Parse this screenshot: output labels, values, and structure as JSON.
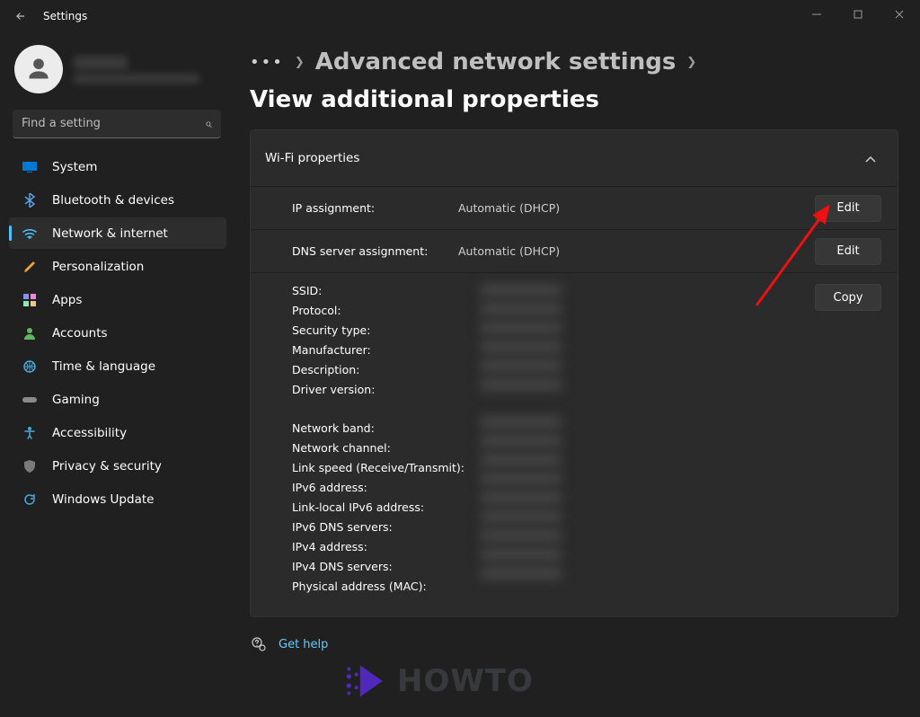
{
  "titlebar": {
    "title": "Settings"
  },
  "search": {
    "placeholder": "Find a setting"
  },
  "sidebar": {
    "items": [
      {
        "label": "System"
      },
      {
        "label": "Bluetooth & devices"
      },
      {
        "label": "Network & internet"
      },
      {
        "label": "Personalization"
      },
      {
        "label": "Apps"
      },
      {
        "label": "Accounts"
      },
      {
        "label": "Time & language"
      },
      {
        "label": "Gaming"
      },
      {
        "label": "Accessibility"
      },
      {
        "label": "Privacy & security"
      },
      {
        "label": "Windows Update"
      }
    ]
  },
  "breadcrumb": {
    "a": "Advanced network settings",
    "b": "View additional properties"
  },
  "card": {
    "title": "Wi-Fi properties",
    "rows": [
      {
        "label": "IP assignment:",
        "value": "Automatic (DHCP)",
        "btn": "Edit"
      },
      {
        "label": "DNS server assignment:",
        "value": "Automatic (DHCP)",
        "btn": "Edit"
      }
    ],
    "detailLabels1": [
      "SSID:",
      "Protocol:",
      "Security type:",
      "Manufacturer:",
      "Description:",
      "Driver version:"
    ],
    "detailLabels2": [
      "Network band:",
      "Network channel:",
      "Link speed (Receive/Transmit):",
      "IPv6 address:",
      "Link-local IPv6 address:",
      "IPv6 DNS servers:",
      "IPv4 address:",
      "IPv4 DNS servers:",
      "Physical address (MAC):"
    ],
    "copyBtn": "Copy"
  },
  "help": {
    "label": "Get help"
  },
  "watermark": {
    "text": "HOWTO"
  }
}
